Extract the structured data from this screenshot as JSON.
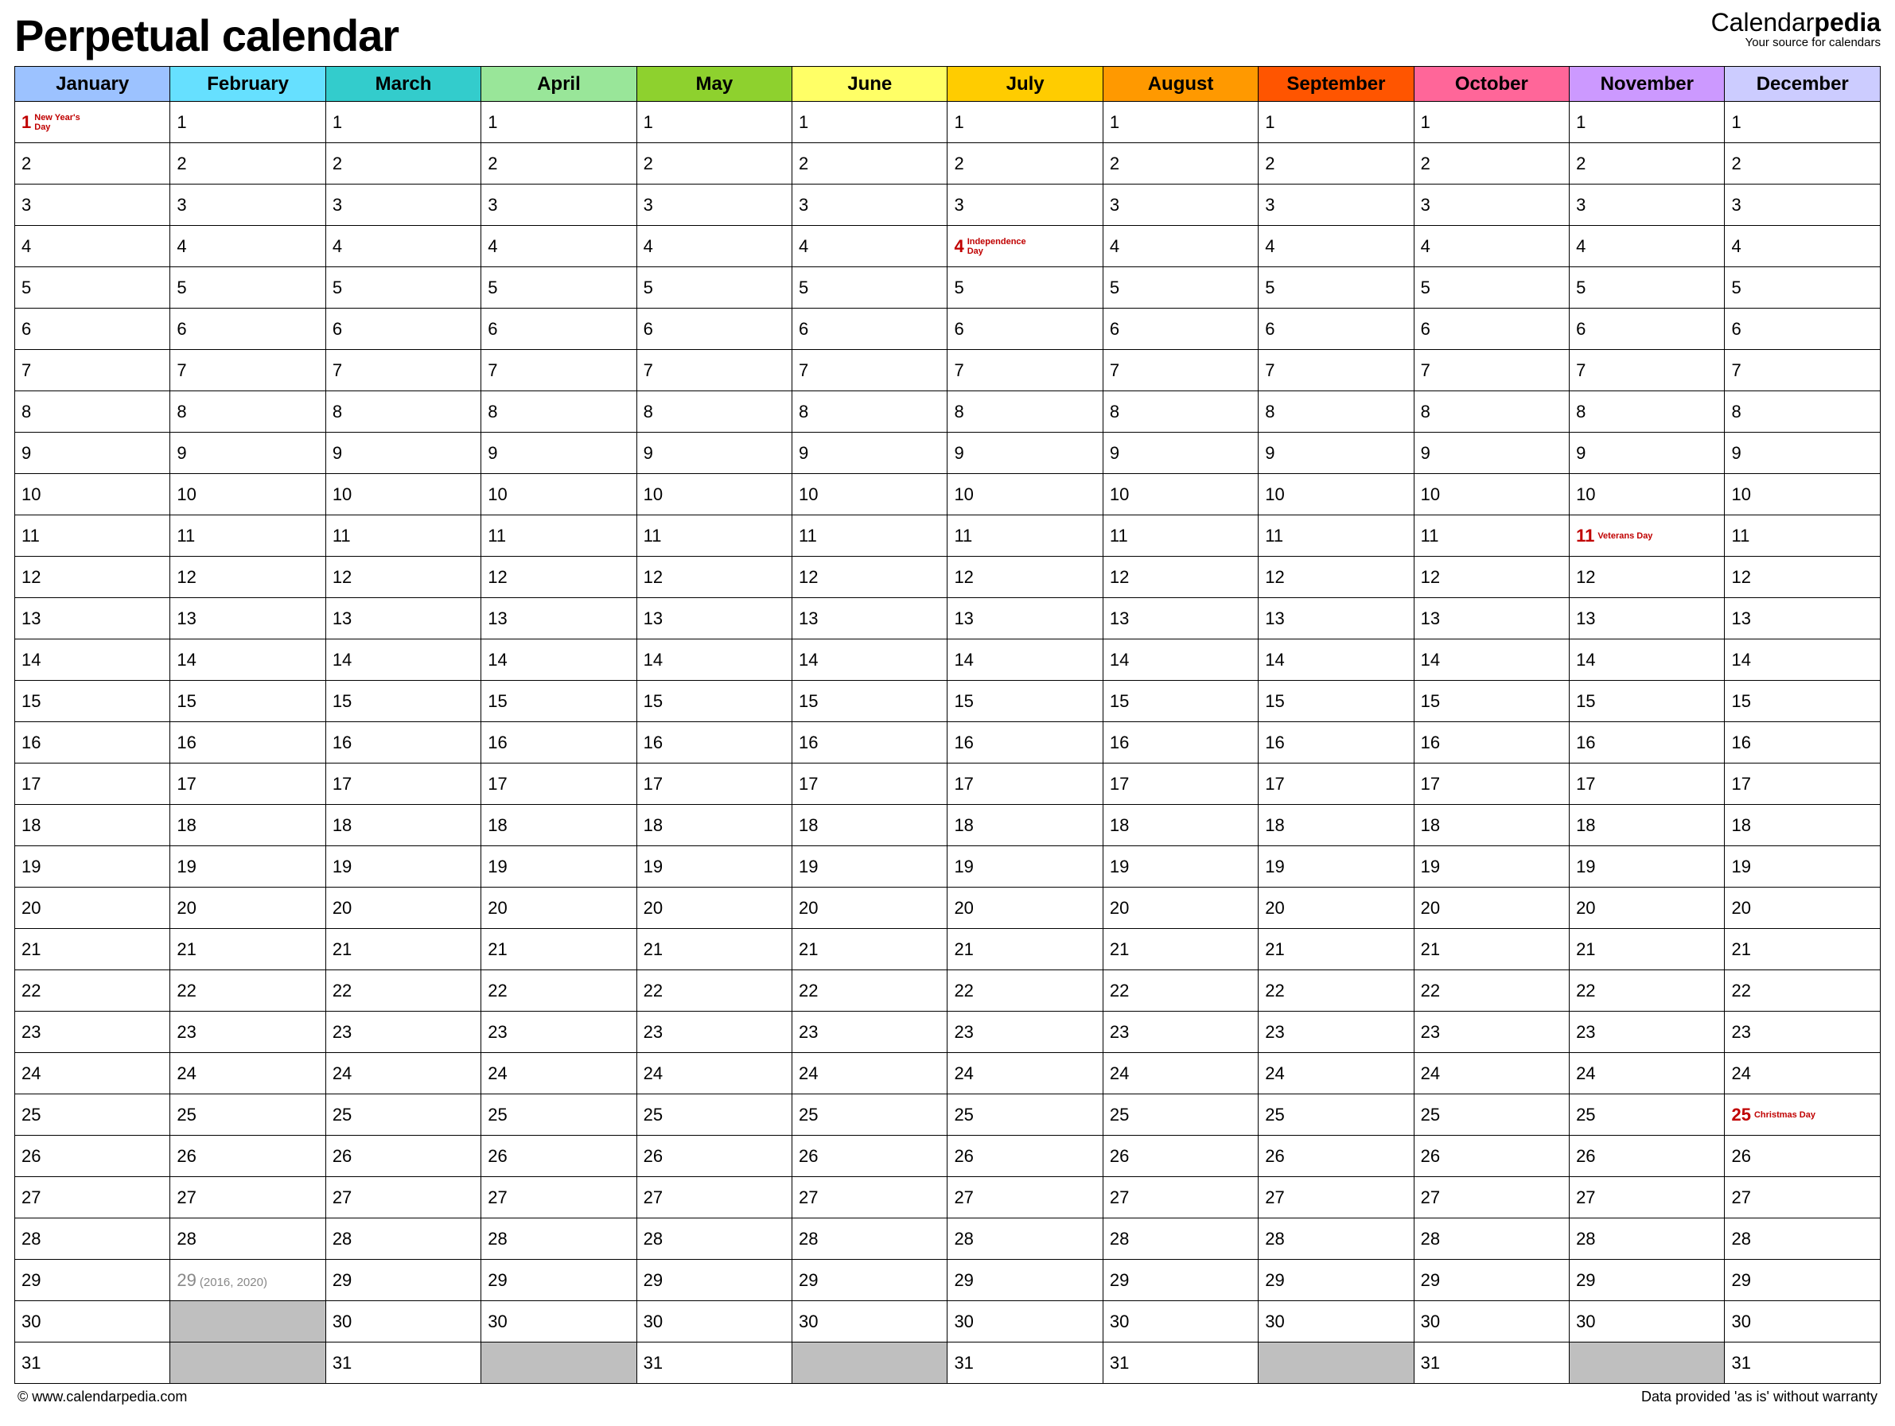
{
  "header": {
    "title": "Perpetual calendar",
    "brand_prefix": "Calendar",
    "brand_suffix": "pedia",
    "brand_tagline": "Your source for calendars"
  },
  "months": [
    {
      "name": "January",
      "color": "#9cc2ff",
      "days": 31
    },
    {
      "name": "February",
      "color": "#66e0ff",
      "days": 29
    },
    {
      "name": "March",
      "color": "#33cccc",
      "days": 31
    },
    {
      "name": "April",
      "color": "#99e699",
      "days": 30
    },
    {
      "name": "May",
      "color": "#8ed12e",
      "days": 31
    },
    {
      "name": "June",
      "color": "#ffff66",
      "days": 30
    },
    {
      "name": "July",
      "color": "#ffcc00",
      "days": 31
    },
    {
      "name": "August",
      "color": "#ff9900",
      "days": 31
    },
    {
      "name": "September",
      "color": "#ff5500",
      "days": 30
    },
    {
      "name": "October",
      "color": "#ff6699",
      "days": 31
    },
    {
      "name": "November",
      "color": "#cc99ff",
      "days": 30
    },
    {
      "name": "December",
      "color": "#ccccff",
      "days": 31
    }
  ],
  "holidays": [
    {
      "month": 0,
      "day": 1,
      "label": "New Year's Day"
    },
    {
      "month": 6,
      "day": 4,
      "label": "Independence Day"
    },
    {
      "month": 10,
      "day": 11,
      "label": "Veterans Day"
    },
    {
      "month": 11,
      "day": 25,
      "label": "Christmas Day"
    }
  ],
  "feb29_note": "(2016, 2020)",
  "max_days": 31,
  "footer": {
    "left": "© www.calendarpedia.com",
    "right": "Data provided 'as is' without warranty"
  }
}
